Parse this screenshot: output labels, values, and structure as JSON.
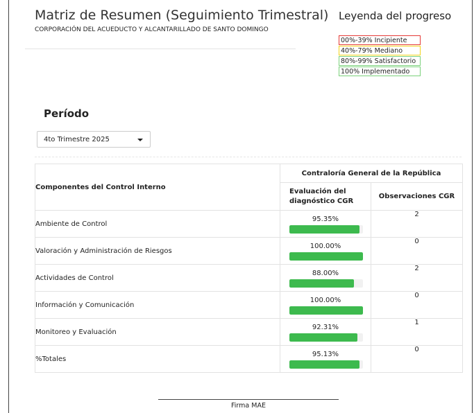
{
  "header": {
    "title": "Matriz de Resumen (Seguimiento Trimestral)",
    "subtitle": "CORPORACIÓN DEL ACUEDUCTO Y ALCANTARILLADO DE SANTO DOMINGO"
  },
  "legend": {
    "title": "Leyenda del progreso",
    "items": [
      {
        "label": "00%-39% Incipiente",
        "color": "#e53935"
      },
      {
        "label": "40%-79% Mediano",
        "color": "#f2d31b"
      },
      {
        "label": "80%-99% Satisfactorio",
        "color": "#7bd17b"
      },
      {
        "label": "100% Implementado",
        "color": "#7bd17b"
      }
    ]
  },
  "period": {
    "label": "Período",
    "selected": "4to Trimestre 2025"
  },
  "table": {
    "components_header": "Componentes del Control Interno",
    "group_header": "Contraloría General de la República",
    "eval_header": "Evaluación del diagnóstico CGR",
    "obs_header": "Observaciones CGR",
    "bar_color": "#3dba4e",
    "rows": [
      {
        "component": "Ambiente de Control",
        "eval": "95.35%",
        "fraction": 0.9535,
        "obs": "2"
      },
      {
        "component": "Valoración y Administración de Riesgos",
        "eval": "100.00%",
        "fraction": 1.0,
        "obs": "0"
      },
      {
        "component": "Actividades de Control",
        "eval": "88.00%",
        "fraction": 0.88,
        "obs": "2"
      },
      {
        "component": "Información y Comunicación",
        "eval": "100.00%",
        "fraction": 1.0,
        "obs": "0"
      },
      {
        "component": "Monitoreo y Evaluación",
        "eval": "92.31%",
        "fraction": 0.9231,
        "obs": "1"
      },
      {
        "component": "%Totales",
        "eval": "95.13%",
        "fraction": 0.9513,
        "obs": "0"
      }
    ]
  },
  "signature": {
    "label": "Firma MAE"
  }
}
